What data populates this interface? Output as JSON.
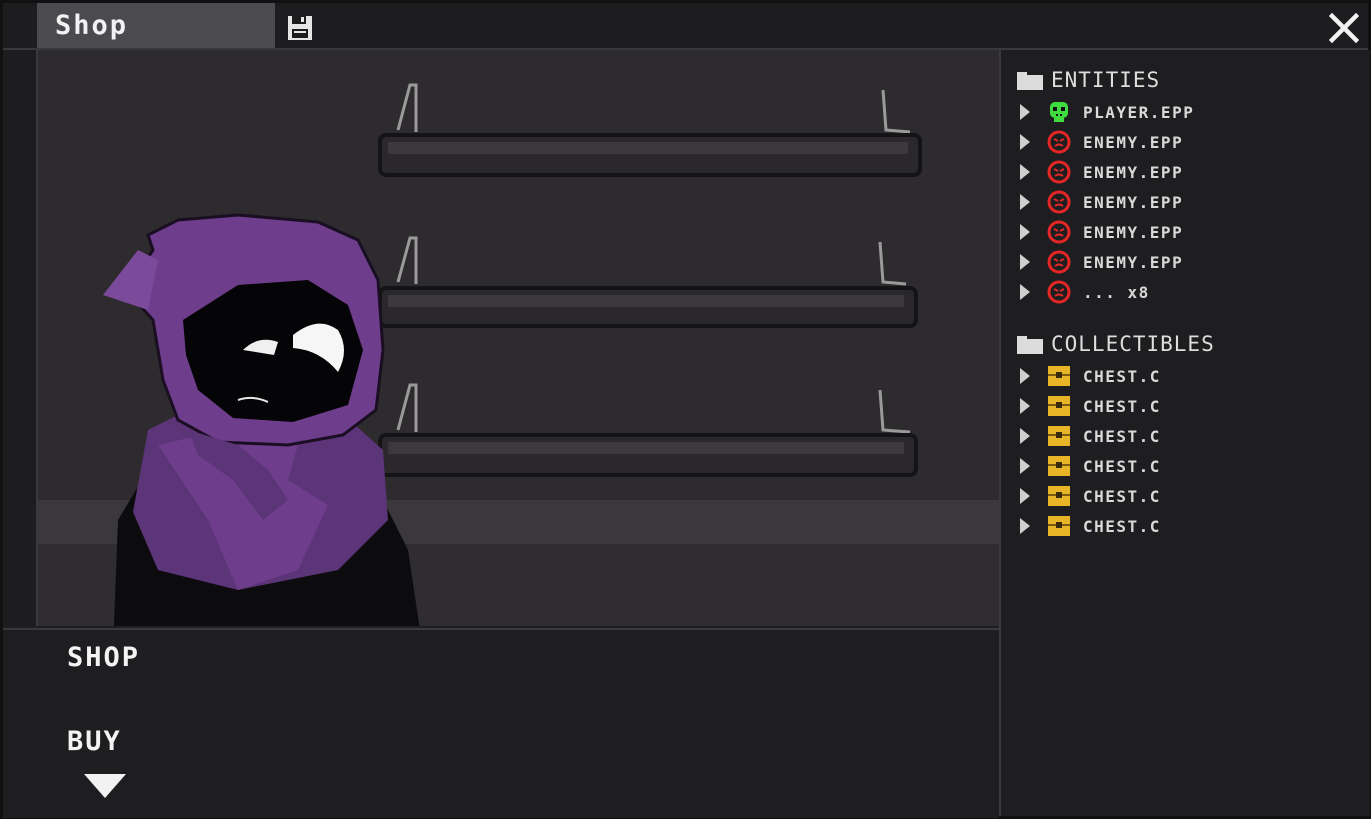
{
  "window": {
    "tab_title": "Shop",
    "icons": {
      "save": "floppy-disk-icon",
      "close": "close-icon"
    }
  },
  "dialog": {
    "speaker": "SHOP",
    "line": "BUY",
    "continue_icon": "triangle-down-icon"
  },
  "tree": {
    "entities": {
      "label": "ENTITIES",
      "items": [
        {
          "label": "PLAYER.EPP",
          "icon": "player-skull-icon",
          "color": "#3fdc3f"
        },
        {
          "label": "ENEMY.EPP",
          "icon": "enemy-face-icon",
          "color": "#e52626"
        },
        {
          "label": "ENEMY.EPP",
          "icon": "enemy-face-icon",
          "color": "#e52626"
        },
        {
          "label": "ENEMY.EPP",
          "icon": "enemy-face-icon",
          "color": "#e52626"
        },
        {
          "label": "ENEMY.EPP",
          "icon": "enemy-face-icon",
          "color": "#e52626"
        },
        {
          "label": "ENEMY.EPP",
          "icon": "enemy-face-icon",
          "color": "#e52626"
        },
        {
          "label": "... x8",
          "icon": "enemy-face-icon",
          "color": "#e52626"
        }
      ]
    },
    "collectibles": {
      "label": "COLLECTIBLES",
      "items": [
        {
          "label": "CHEST.C",
          "icon": "chest-icon",
          "color": "#e8b527"
        },
        {
          "label": "CHEST.C",
          "icon": "chest-icon",
          "color": "#e8b527"
        },
        {
          "label": "CHEST.C",
          "icon": "chest-icon",
          "color": "#e8b527"
        },
        {
          "label": "CHEST.C",
          "icon": "chest-icon",
          "color": "#e8b527"
        },
        {
          "label": "CHEST.C",
          "icon": "chest-icon",
          "color": "#e8b527"
        },
        {
          "label": "CHEST.C",
          "icon": "chest-icon",
          "color": "#e8b527"
        }
      ]
    }
  },
  "colors": {
    "background": "#1f1e20",
    "tab": "#4b4a4e",
    "hood": "#6e3d8c",
    "shelf": "#2a282b"
  }
}
